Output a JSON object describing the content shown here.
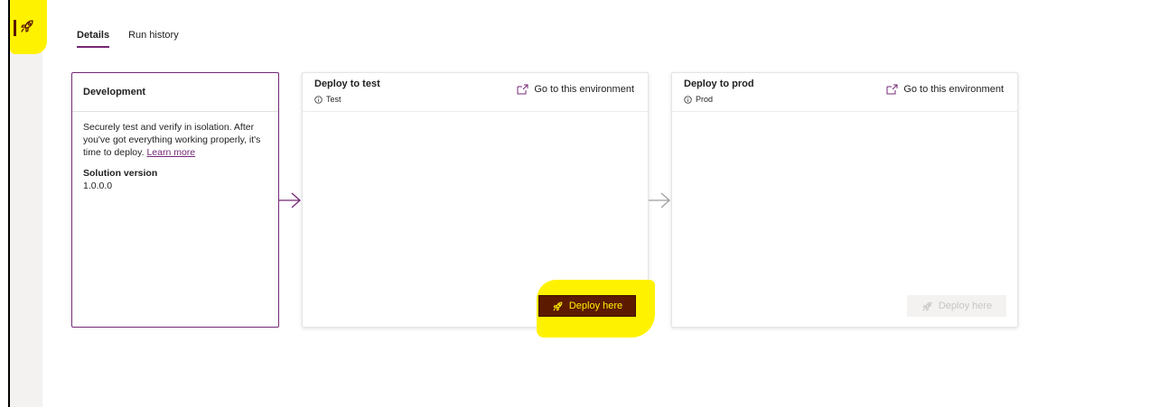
{
  "tabs": [
    {
      "label": "Details",
      "active": true
    },
    {
      "label": "Run history",
      "active": false
    }
  ],
  "development": {
    "title": "Development",
    "description": "Securely test and verify in isolation. After you've got everything working properly, it's time to deploy. ",
    "learn_more": "Learn more",
    "version_label": "Solution version",
    "version_value": "1.0.0.0"
  },
  "stages": [
    {
      "title": "Deploy to test",
      "environment": "Test",
      "goto_label": "Go to this environment",
      "deploy_label": "Deploy here",
      "deploy_enabled": true
    },
    {
      "title": "Deploy to prod",
      "environment": "Prod",
      "goto_label": "Go to this environment",
      "deploy_label": "Deploy here",
      "deploy_enabled": false
    }
  ],
  "icons": {
    "rail": "rocket-icon",
    "env_info": "info-icon",
    "goto": "open-external-icon",
    "deploy": "rocket-icon"
  },
  "colors": {
    "accent": "#742774",
    "primary_button_bg": "#5c1a00",
    "primary_button_text": "#fff200",
    "highlight": "#fff200"
  }
}
